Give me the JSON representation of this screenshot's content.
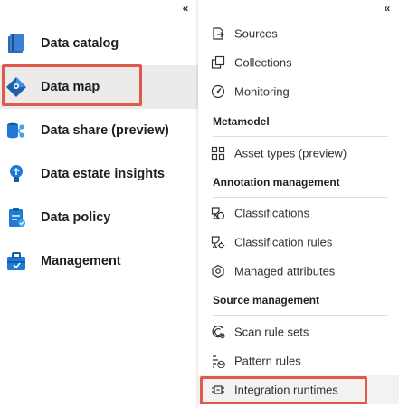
{
  "left_nav": {
    "collapse_glyph": "«",
    "items": [
      {
        "label": "Data catalog",
        "icon": "data-catalog-icon"
      },
      {
        "label": "Data map",
        "icon": "data-map-icon",
        "selected": true,
        "highlighted": true
      },
      {
        "label": "Data share (preview)",
        "icon": "data-share-icon"
      },
      {
        "label": "Data estate insights",
        "icon": "insights-lightbulb-icon"
      },
      {
        "label": "Data policy",
        "icon": "policy-clipboard-icon"
      },
      {
        "label": "Management",
        "icon": "management-toolbox-icon"
      }
    ]
  },
  "sub_nav": {
    "collapse_glyph": "«",
    "top_items": [
      {
        "label": "Sources",
        "icon": "sources-icon"
      },
      {
        "label": "Collections",
        "icon": "collections-icon"
      },
      {
        "label": "Monitoring",
        "icon": "monitoring-gauge-icon"
      }
    ],
    "sections": [
      {
        "header": "Metamodel",
        "items": [
          {
            "label": "Asset types (preview)",
            "icon": "asset-types-icon"
          }
        ]
      },
      {
        "header": "Annotation management",
        "items": [
          {
            "label": "Classifications",
            "icon": "classifications-icon"
          },
          {
            "label": "Classification rules",
            "icon": "classification-rules-icon"
          },
          {
            "label": "Managed attributes",
            "icon": "managed-attributes-icon"
          }
        ]
      },
      {
        "header": "Source management",
        "items": [
          {
            "label": "Scan rule sets",
            "icon": "scan-rule-sets-icon"
          },
          {
            "label": "Pattern rules",
            "icon": "pattern-rules-icon"
          },
          {
            "label": "Integration runtimes",
            "icon": "integration-runtimes-icon",
            "highlighted": true
          }
        ]
      }
    ]
  },
  "colors": {
    "highlight": "#e05a4b",
    "selected_bg": "#edebe9",
    "accent_blue": "#0078d4"
  }
}
